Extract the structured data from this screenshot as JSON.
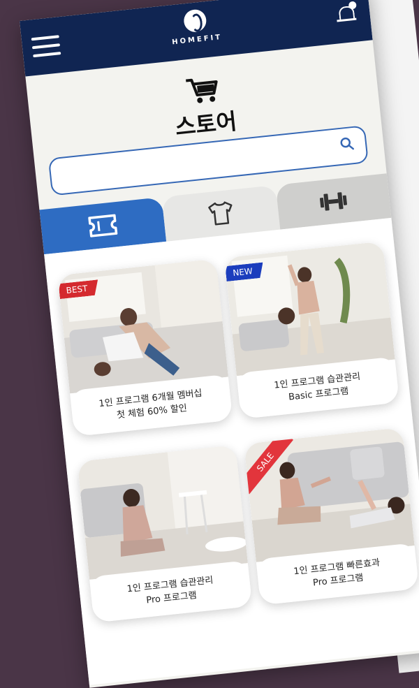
{
  "header": {
    "brand": "HOMEFIT",
    "menu_icon": "hamburger-menu-icon",
    "notification_icon": "bell-icon",
    "colors": {
      "header_bg": "#102552",
      "accent": "#2e6cc2"
    }
  },
  "store": {
    "icon": "cart-icon",
    "title": "스토어"
  },
  "search": {
    "value": "",
    "placeholder": "",
    "icon": "search-icon"
  },
  "tabs": [
    {
      "icon": "ticket-icon",
      "active": true
    },
    {
      "icon": "tshirt-icon",
      "active": false
    },
    {
      "icon": "dumbbell-icon",
      "active": false
    }
  ],
  "products": [
    {
      "badge": "BEST",
      "line1": "1인 프로그램 6개월 멤버십",
      "line2": "첫 체험 60% 할인"
    },
    {
      "badge": "NEW",
      "line1": "1인 프로그램 습관관리",
      "line2": "Basic 프로그램"
    },
    {
      "badge": "",
      "line1": "1인 프로그램 습관관리",
      "line2": "Pro 프로그램"
    },
    {
      "badge": "SALE",
      "line1": "1인 프로그램 빠른효과",
      "line2": "Pro 프로그램"
    }
  ]
}
